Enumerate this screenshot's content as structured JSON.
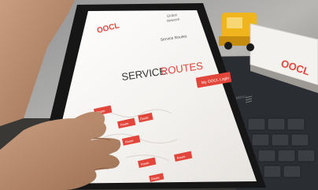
{
  "tablet_app": {
    "logo": "OOCL",
    "header_line1": "Global",
    "header_line2": "Network",
    "service_selector": "Service Routes",
    "title_part1": "SERVICE",
    "title_part2": "ROUTES",
    "cta_button": "My OOCL Login",
    "menu_label": "MENU",
    "route_tags": [
      "Route",
      "Route",
      "Route",
      "Route",
      "Route",
      "Route",
      "Route"
    ]
  },
  "truck_model": {
    "container_brand": "OOCL"
  },
  "colors": {
    "brand_red": "#e2453a",
    "screen_bg": "#f3f1ee",
    "tablet_frame": "#161616",
    "truck_yellow": "#f0b51c",
    "keyboard": "#2a2d31"
  }
}
